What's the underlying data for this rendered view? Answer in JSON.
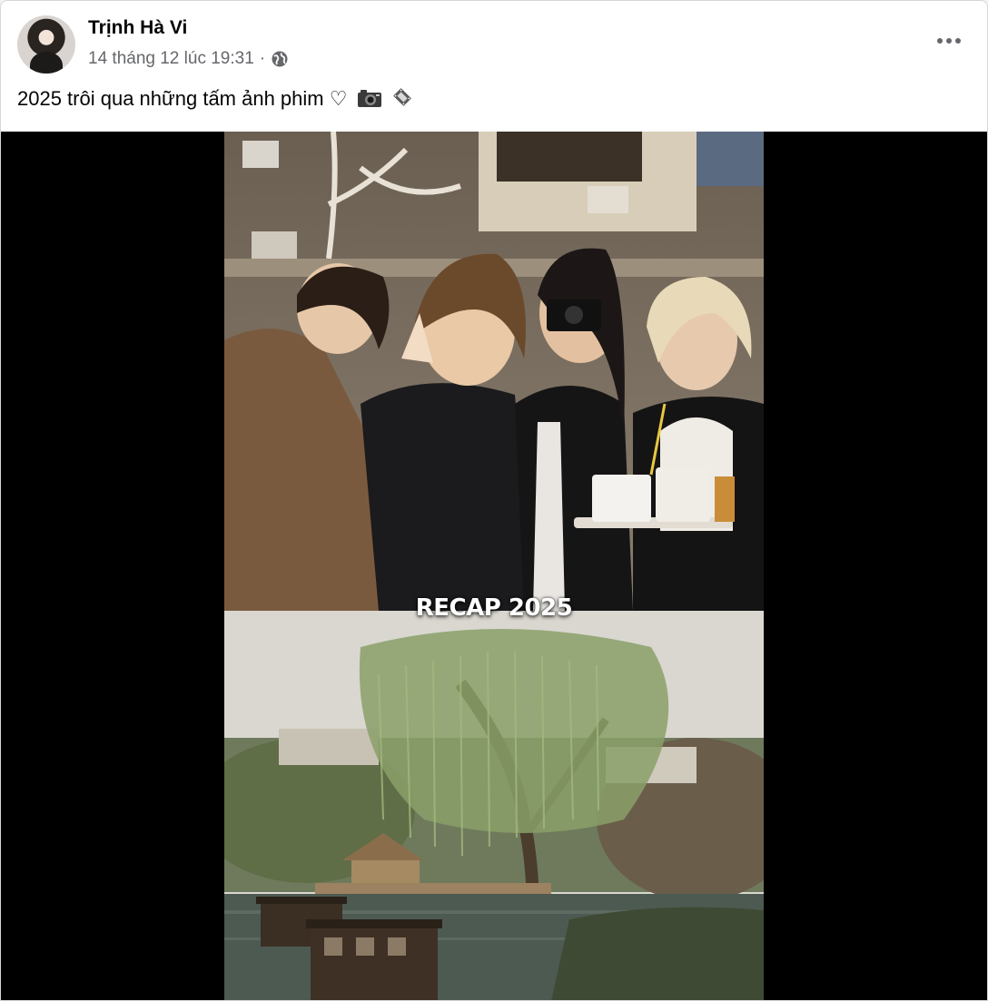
{
  "post": {
    "author": "Trịnh Hà Vi",
    "timestamp": "14 tháng 12 lúc 19:31",
    "separator": "·",
    "privacy_icon": "globe-icon",
    "more_icon": "more-horizontal-icon",
    "caption_text": "2025 trôi qua những tấm ảnh phim ♡",
    "caption_icons": [
      "camera-icon",
      "film-strip-icon"
    ]
  },
  "media": {
    "overlay_text": "RECAP 2025",
    "top_photo": "group-photo-friends",
    "bottom_photo": "willow-lake-boats-photo"
  },
  "colors": {
    "primary_text": "#050505",
    "secondary_text": "#65676b",
    "media_background": "#000000"
  }
}
